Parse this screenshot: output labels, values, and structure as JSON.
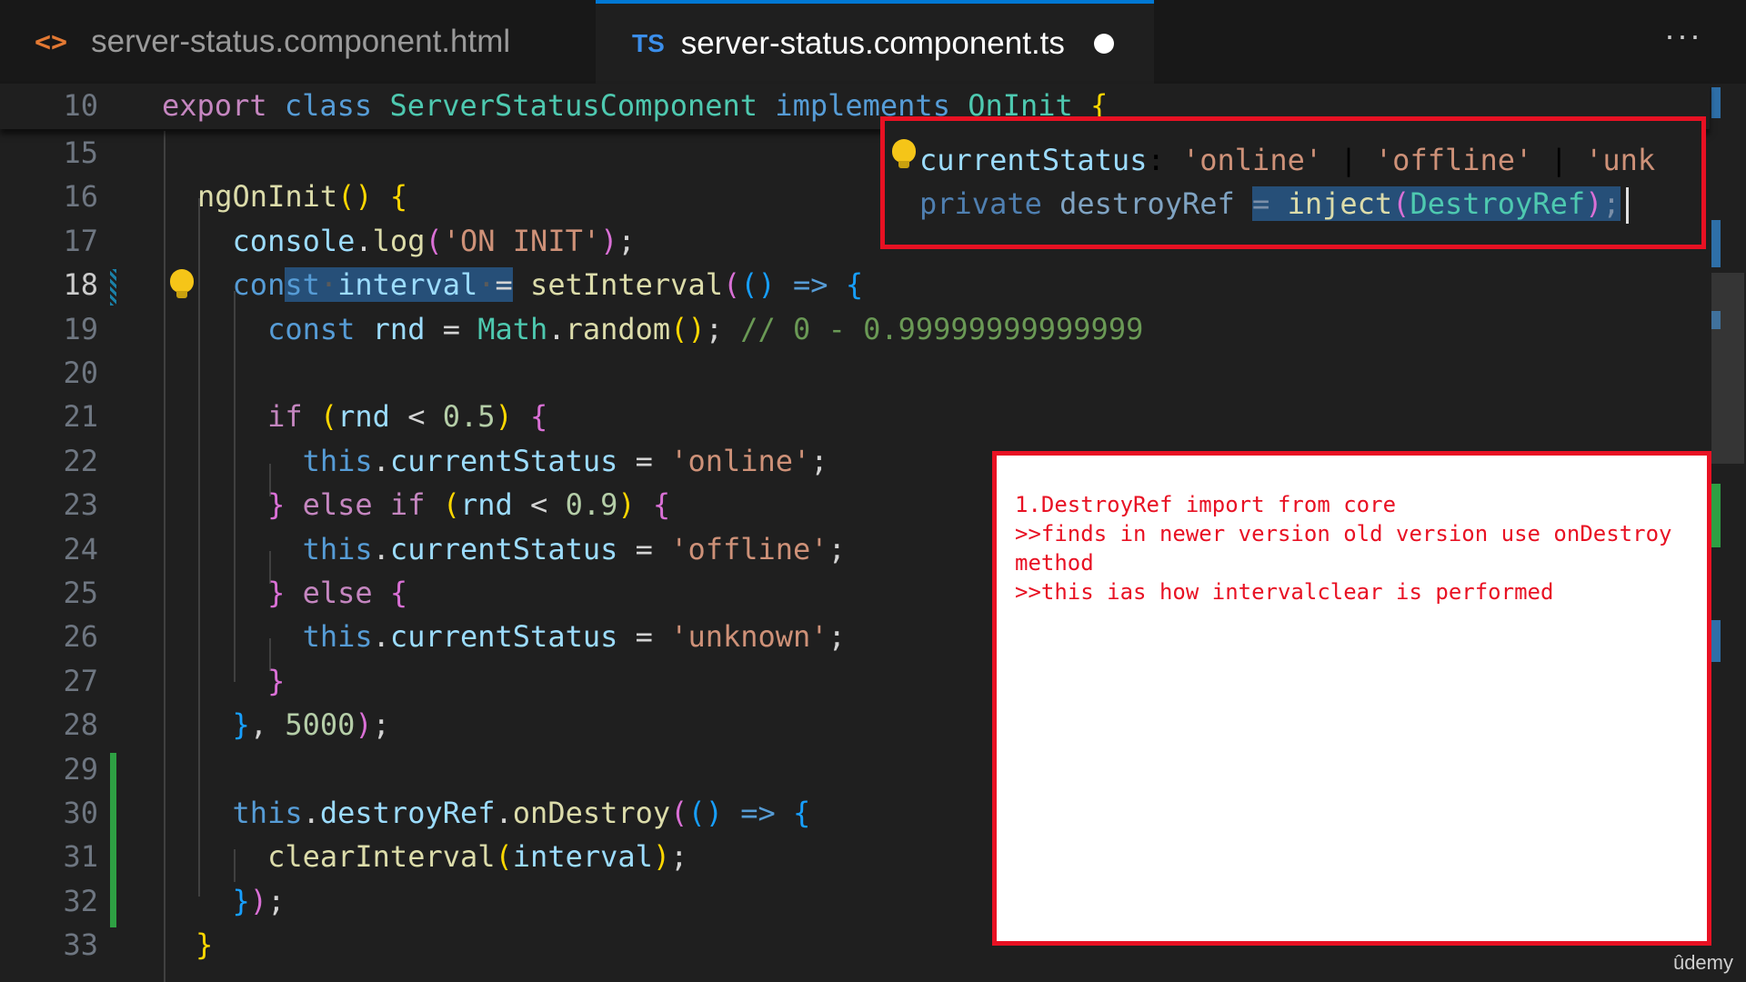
{
  "tabs": [
    {
      "icon": "html-icon",
      "icon_text": "<>",
      "label": "server-status.component.html"
    },
    {
      "icon": "ts-icon",
      "icon_text": "TS",
      "label": "server-status.component.ts"
    }
  ],
  "more_label": "···",
  "sticky": {
    "line_number": "10"
  },
  "line_numbers": [
    "15",
    "16",
    "17",
    "18",
    "19",
    "20",
    "21",
    "22",
    "23",
    "24",
    "25",
    "26",
    "27",
    "28",
    "29",
    "30",
    "31",
    "32",
    "33"
  ],
  "overlay_top": {
    "line1": {
      "name": "currentStatus",
      "colon": ":",
      "s1": "'online'",
      "bar": "|",
      "s2": "'offline'",
      "s3": "'unk"
    },
    "line2": {
      "kw": "private",
      "name": "destroyRef",
      "eq": "=",
      "fn": "inject",
      "arg": "DestroyRef",
      "end": ";"
    }
  },
  "note": {
    "text": "1.DestroyRef import from core\n>>finds in newer version old version use onDestroy method\n>>this ias how intervalclear is performed"
  },
  "watermark": "ûdemy"
}
